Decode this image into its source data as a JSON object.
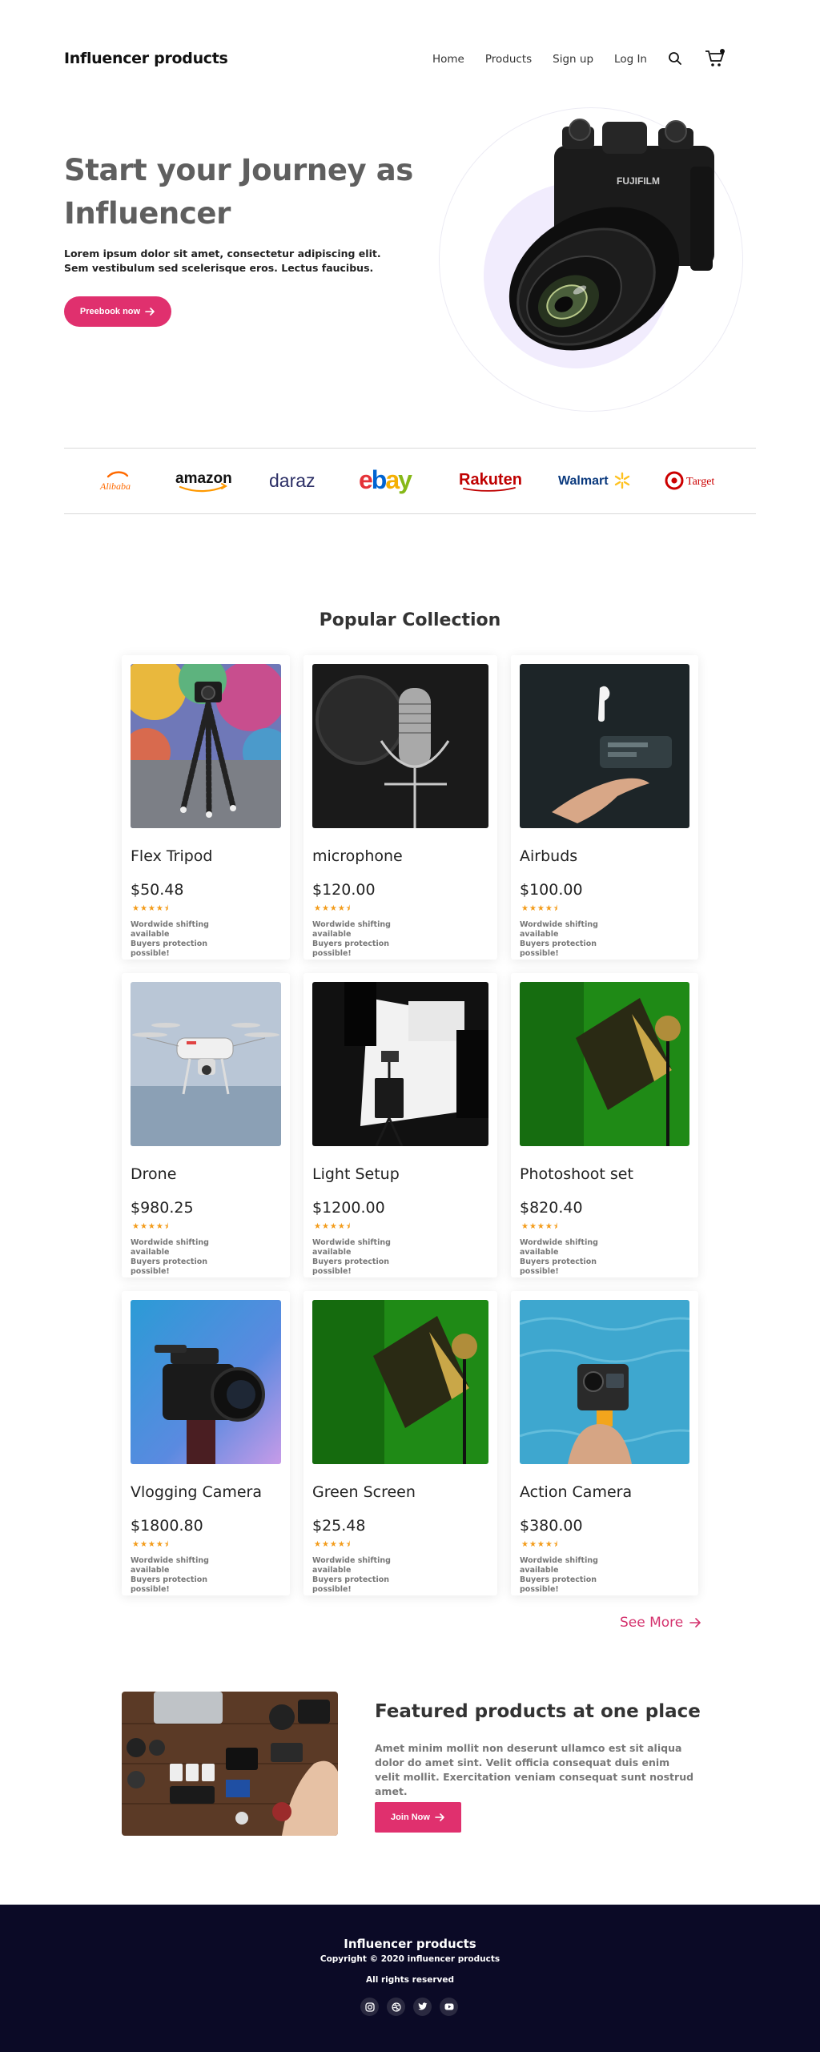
{
  "header": {
    "brand": "Influencer products",
    "nav": [
      "Home",
      "Products",
      "Sign up",
      "Log In"
    ]
  },
  "hero": {
    "title": "Start your Journey as Influencer",
    "description": "Lorem ipsum dolor sit amet, consectetur adipiscing elit. Sem vestibulum sed scelerisque eros. Lectus faucibus.",
    "button_label": "Preebook now"
  },
  "partners": [
    "Alibaba",
    "amazon",
    "daraz",
    "ebay",
    "Rakuten",
    "Walmart",
    "Target"
  ],
  "collection": {
    "title": "Popular Collection",
    "products": [
      {
        "name": "Flex Tripod",
        "price": "$50.48",
        "rating": 4.5,
        "shipping": "Wordwide shifting available",
        "protection": "Buyers protection possible!"
      },
      {
        "name": "microphone",
        "price": "$120.00",
        "rating": 4.5,
        "shipping": "Wordwide shifting available",
        "protection": "Buyers protection possible!"
      },
      {
        "name": "Airbuds",
        "price": "$100.00",
        "rating": 4.5,
        "shipping": "Wordwide shifting available",
        "protection": "Buyers protection possible!"
      },
      {
        "name": "Drone",
        "price": "$980.25",
        "rating": 4.5,
        "shipping": "Wordwide shifting available",
        "protection": "Buyers protection possible!"
      },
      {
        "name": "Light Setup",
        "price": "$1200.00",
        "rating": 4.5,
        "shipping": "Wordwide shifting available",
        "protection": "Buyers protection possible!"
      },
      {
        "name": "Photoshoot set",
        "price": "$820.40",
        "rating": 4.5,
        "shipping": "Wordwide shifting available",
        "protection": "Buyers protection possible!"
      },
      {
        "name": "Vlogging Camera",
        "price": "$1800.80",
        "rating": 4.5,
        "shipping": "Wordwide shifting available",
        "protection": "Buyers protection possible!"
      },
      {
        "name": "Green Screen",
        "price": "$25.48",
        "rating": 4.5,
        "shipping": "Wordwide shifting available",
        "protection": "Buyers protection possible!"
      },
      {
        "name": "Action Camera",
        "price": "$380.00",
        "rating": 4.5,
        "shipping": "Wordwide shifting available",
        "protection": "Buyers protection possible!"
      }
    ],
    "see_more": "See More"
  },
  "featured": {
    "title": "Featured products at one place",
    "description": "Amet minim mollit non deserunt ullamco est sit aliqua dolor do amet sint. Velit officia consequat duis enim velit mollit. Exercitation veniam consequat sunt nostrud amet.",
    "button_label": "Join Now"
  },
  "footer": {
    "brand": "Influencer products",
    "copyright": "Copyright © 2020 influencer products",
    "rights": "All rights reserved",
    "socials": [
      "instagram-icon",
      "dribbble-icon",
      "twitter-icon",
      "youtube-icon"
    ]
  },
  "colors": {
    "accent": "#e0306e",
    "footer_bg": "#0b0a26",
    "star": "#f39c1b",
    "heading": "#5f5f5f"
  }
}
